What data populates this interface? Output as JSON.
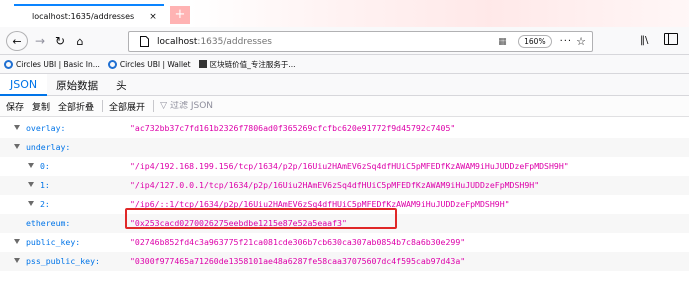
{
  "browser": {
    "tab_title": "localhost:1635/addresses",
    "tab_close": "×",
    "new_tab": "+",
    "url_host": "localhost",
    "url_path": ":1635/addresses",
    "zoom": "160%",
    "more": "···",
    "bookmarks": [
      {
        "label": "Circles UBI | Basic In...",
        "icon": "circles-logo"
      },
      {
        "label": "Circles UBI | Wallet",
        "icon": "circles-logo"
      },
      {
        "label": "区块链价值_专注服务于...",
        "icon": "square-icon"
      }
    ]
  },
  "viewer": {
    "tabs": [
      "JSON",
      "原始数据",
      "头"
    ],
    "active_tab": "JSON",
    "toolbar": {
      "save": "保存",
      "copy": "复制",
      "collapse_all": "全部折叠",
      "expand_all": "全部展开",
      "filter_placeholder": "过滤 JSON"
    }
  },
  "json_rows": [
    {
      "key": "overlay:",
      "value": "\"ac732bb37c7fd161b2326f7806ad0f365269cfcfbc620e91772f9d45792c7405\"",
      "twisty": "open",
      "indent": 0
    },
    {
      "key": "underlay:",
      "value": "",
      "twisty": "open",
      "indent": 0
    },
    {
      "key": "0:",
      "value": "\"/ip4/192.168.199.156/tcp/1634/p2p/16Uiu2HAmEV6zSq4dfHUiC5pMFEDfKzAWAM9iHuJUDDzeFpMDSH9H\"",
      "twisty": "open",
      "indent": 1
    },
    {
      "key": "1:",
      "value": "\"/ip4/127.0.0.1/tcp/1634/p2p/16Uiu2HAmEV6zSq4dfHUiC5pMFEDfKzAWAM9iHuJUDDzeFpMDSH9H\"",
      "twisty": "open",
      "indent": 1
    },
    {
      "key": "2:",
      "value": "\"/ip6/::1/tcp/1634/p2p/16Uiu2HAmEV6zSq4dfHUiC5pMFEDfKzAWAM9iHuJUDDzeFpMDSH9H\"",
      "twisty": "open",
      "indent": 1
    },
    {
      "key": "ethereum:",
      "value": "\"0x253cacd0270026275eebdbe1215e87e52a5eaaf3\"",
      "twisty": "none",
      "indent": 0
    },
    {
      "key": "public_key:",
      "value": "\"02746b852fd4c3a963775f21ca081cde306b7cb630ca307ab0854b7c8a6b30e299\"",
      "twisty": "open",
      "indent": 0
    },
    {
      "key": "pss_public_key:",
      "value": "\"0300f977465a71260de1358101ae48a6287fe58caa37075607dc4f595cab97d43a\"",
      "twisty": "open",
      "indent": 0
    }
  ],
  "colors": {
    "key": "#0074e8",
    "string": "#dd00a9",
    "highlight": "#e02828"
  }
}
